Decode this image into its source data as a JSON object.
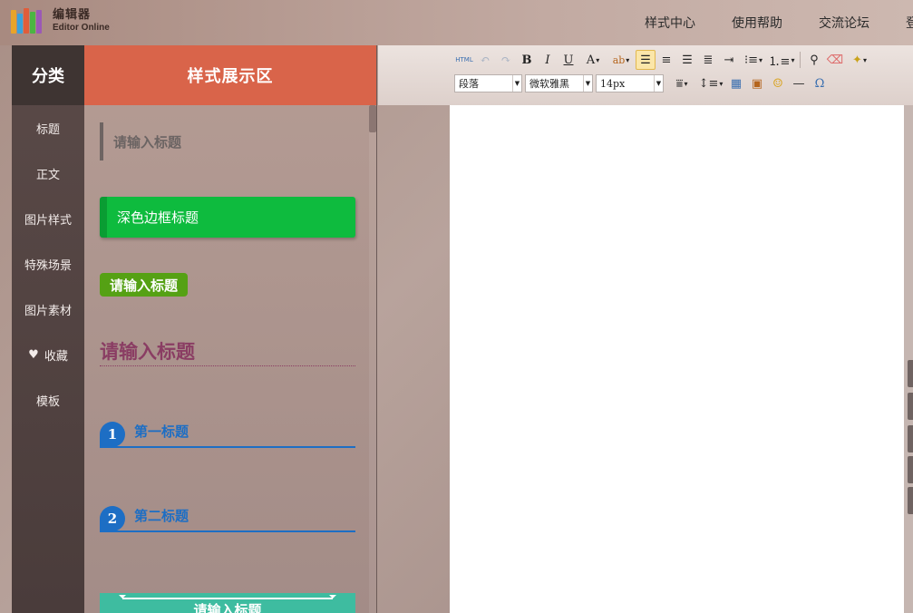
{
  "brand": {
    "name_cn": "编辑器",
    "name_en": "Editor Online"
  },
  "topnav": [
    "样式中心",
    "使用帮助",
    "交流论坛",
    "登录"
  ],
  "categories": {
    "header": "分类",
    "items": [
      "标题",
      "正文",
      "图片样式",
      "特殊场景",
      "图片素材",
      "收藏",
      "模板"
    ]
  },
  "styles": {
    "header": "样式展示区",
    "s1": "请输入标题",
    "s2": "深色边框标题",
    "s3": "请输入标题",
    "s4": "请输入标题",
    "s5_num": "1",
    "s5": "第一标题",
    "s6_num": "2",
    "s6": "第二标题",
    "s7": "请输入标题"
  },
  "toolbar": {
    "row1": [
      "HTML",
      "undo",
      "redo",
      "B",
      "I",
      "U",
      "A",
      "ab",
      "align-left",
      "align-center",
      "align-right",
      "justify",
      "indent",
      "unordered-list",
      "ordered-list",
      "binoculars",
      "eraser",
      "magic-wand"
    ],
    "paragraph": "段落",
    "font": "微软雅黑",
    "size": "14px",
    "row2_icons": [
      "row-spacing",
      "line-height",
      "table",
      "image",
      "emoticon",
      "horizontal-rule",
      "omega"
    ]
  },
  "colors": {
    "accent": "#d9644a",
    "green": "#0ebb3e",
    "blue": "#1d6ec4",
    "teal": "#3ebca0",
    "purple": "#8a3d63"
  }
}
